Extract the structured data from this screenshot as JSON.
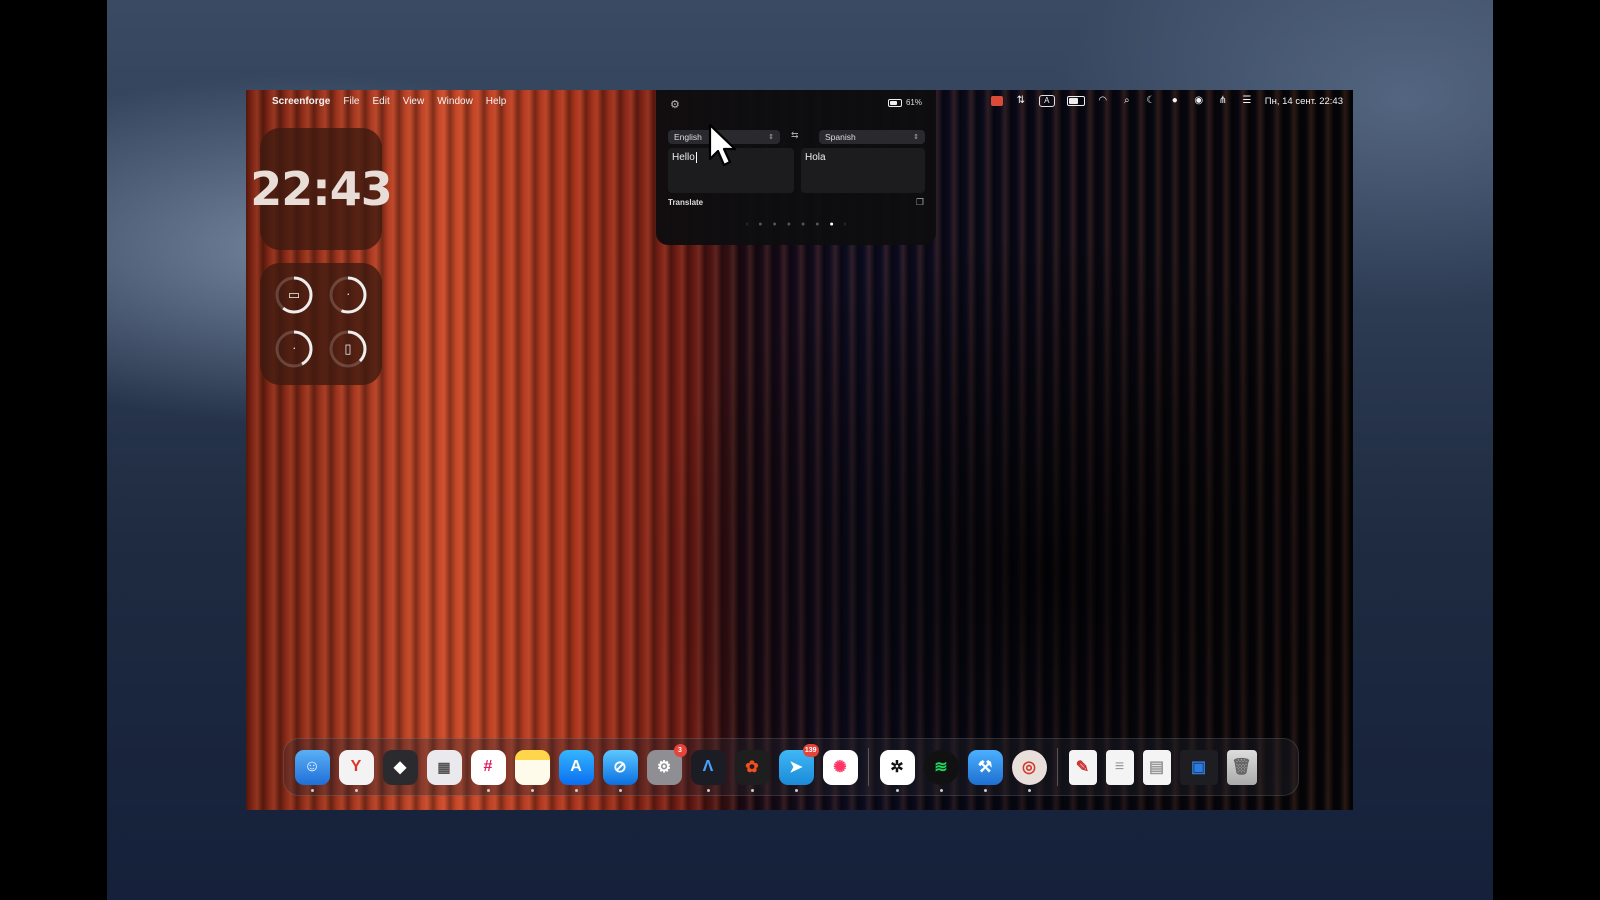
{
  "menubar": {
    "app_name": "Screenforge",
    "menus": [
      "File",
      "Edit",
      "View",
      "Window",
      "Help"
    ],
    "datetime": "Пн, 14 сент. 22:43"
  },
  "widgets": {
    "clock_time": "22:43"
  },
  "translate_popup": {
    "battery_percent": "61%",
    "source_language": "English",
    "target_language": "Spanish",
    "source_text": "Hello",
    "translated_text": "Hola",
    "translate_label": "Translate"
  },
  "dock": {
    "badges": {
      "system_settings": "3",
      "telegram": "139"
    }
  },
  "colors": {
    "accent_red": "#e6433b",
    "popup_bg": "#0e0e10"
  }
}
